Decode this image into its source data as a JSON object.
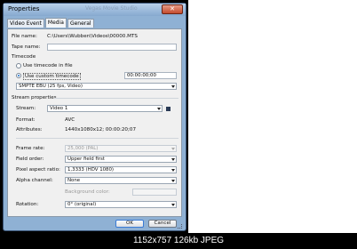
{
  "window": {
    "title": "Properties",
    "background_title": "Vegas Movie Studio",
    "close_label": "✕"
  },
  "tabs": [
    {
      "label": "Video Event"
    },
    {
      "label": "Media"
    },
    {
      "label": "General"
    }
  ],
  "media": {
    "file_name_label": "File name:",
    "file_name_value": "C:\\Users\\Wubben\\Videos\\00000.MTS",
    "tape_name_label": "Tape name:",
    "tape_name_value": "",
    "timecode_label": "Timecode",
    "timecode_in_file_label": "Use timecode in file",
    "custom_timecode_label": "Use custom timecode",
    "custom_timecode_value": "00:00:00;00",
    "timecode_format": "SMPTE EBU (25 fps, Video)",
    "stream_properties_label": "Stream properties",
    "stream_label": "Stream:",
    "stream_value": "Video 1",
    "format_label": "Format:",
    "format_value": "AVC",
    "attributes_label": "Attributes:",
    "attributes_value": "1440x1080x12; 00:00:20;07",
    "frame_rate_label": "Frame rate:",
    "frame_rate_value": "25,000 (PAL)",
    "field_order_label": "Field order:",
    "field_order_value": "Upper field first",
    "pixel_aspect_label": "Pixel aspect ratio:",
    "pixel_aspect_value": "1,3333 (HDV 1080)",
    "alpha_channel_label": "Alpha channel:",
    "alpha_channel_value": "None",
    "background_color_label": "Background color:",
    "rotation_label": "Rotation:",
    "rotation_value": "0° (original)"
  },
  "buttons": {
    "ok": "OK",
    "cancel": "Cancel"
  },
  "status": {
    "text": "1152x757  126kb JPEG"
  }
}
